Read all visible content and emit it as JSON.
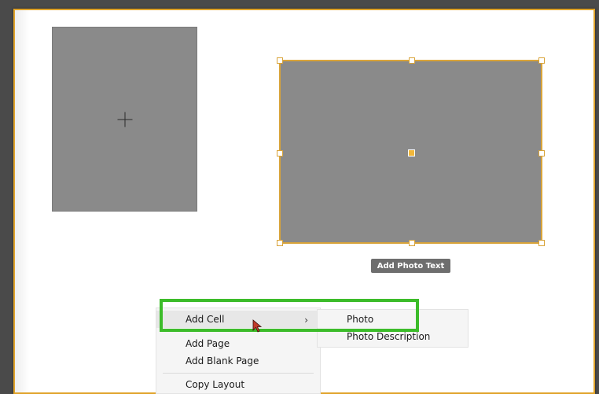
{
  "canvas": {
    "accent_color": "#e0a32a",
    "placeholder_color": "#8a8a8a"
  },
  "cells": [
    {
      "name": "empty-photo-cell",
      "icon": "plus-icon"
    },
    {
      "name": "selected-photo-cell",
      "icon": "center-handle"
    }
  ],
  "caption_button": {
    "label": "Add Photo Text"
  },
  "context_menu": {
    "items": [
      {
        "label": "Add Cell",
        "has_submenu": true
      },
      {
        "label": "Add Page"
      },
      {
        "label": "Add Blank Page"
      },
      {
        "label": "Copy Layout"
      }
    ]
  },
  "submenu": {
    "items": [
      {
        "label": "Photo"
      },
      {
        "label": "Photo Description"
      }
    ]
  },
  "annotation": {
    "highlight_color": "#3cbc2a"
  }
}
